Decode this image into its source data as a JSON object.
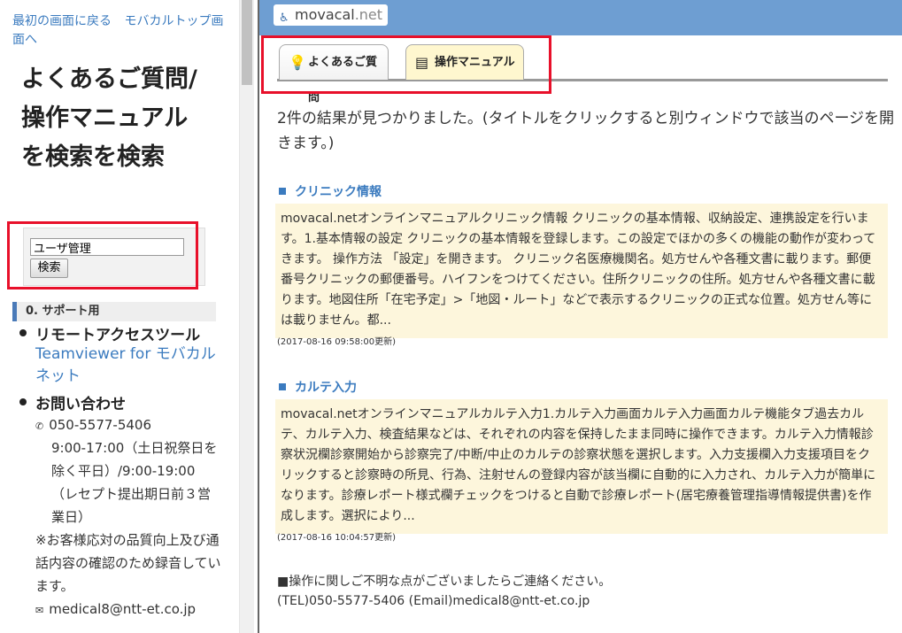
{
  "left_pane": {
    "link_back": "最初の画面に戻る",
    "link_top": "モバカルトップ画面へ",
    "title": "よくあるご質問/操作マニュアルを検索を検索",
    "search_value": "ユーザ管理",
    "search_button": "検索",
    "section_heading": "0. サポート用",
    "items": [
      {
        "title": "リモートアクセスツール",
        "link": "Teamviewer for モバカルネット"
      },
      {
        "title": "お問い合わせ"
      }
    ],
    "contact": {
      "phone": "050-5577-5406",
      "hours": "9:00-17:00（土日祝祭日を除く平日）/9:00-19:00（レセプト提出期日前３営業日）",
      "note": "※お客様応対の品質向上及び通話内容の確認のため録音しています。",
      "email": "medical8@ntt-et.co.jp"
    }
  },
  "header": {
    "logo_main": "movacal",
    "logo_net": ".net",
    "logo_icon": "movacal-logo-icon"
  },
  "tabs": [
    {
      "label": "よくあるご質問",
      "icon": "lightbulb-icon"
    },
    {
      "label": "操作マニュアル",
      "icon": "manual-book-icon"
    }
  ],
  "results_message": "2件の結果が見つかりました。(タイトルをクリックすると別ウィンドウで該当のページを開きます。)",
  "results": [
    {
      "title": "クリニック情報",
      "snippet": "movacal.netオンラインマニュアルクリニック情報 クリニックの基本情報、収納設定、連携設定を行います。1.基本情報の設定 クリニックの基本情報を登録します。この設定でほかの多くの機能の動作が変わってきます。 操作方法 「設定」を開きます。 クリニック名医療機関名。処方せんや各種文書に載ります。郵便番号クリニックの郵便番号。ハイフンをつけてください。住所クリニックの住所。処方せんや各種文書に載ります。地図住所「在宅予定」>「地図・ルート」などで表示するクリニックの正式な位置。処方せん等には載りません。都...",
      "updated": "(2017-08-16 09:58:00更新)"
    },
    {
      "title": "カルテ入力",
      "snippet": "movacal.netオンラインマニュアルカルテ入力1.カルテ入力画面カルテ入力画面カルテ機能タブ過去カルテ、カルテ入力、検査結果などは、それぞれの内容を保持したまま同時に操作できます。カルテ入力情報診察状況欄診察開始から診察完了/中断/中止のカルテの診察状態を選択します。入力支援欄入力支援項目をクリックすると診察時の所見、行為、注射せんの登録内容が該当欄に自動的に入力され、カルテ入力が簡単になります。診療レポート様式欄チェックをつけると自動で診療レポート(居宅療養管理指導情報提供書)を作成します。選択により...",
      "updated": "(2017-08-16 10:04:57更新)"
    }
  ],
  "footer": {
    "line1": "■操作に関しご不明な点がございましたらご連絡ください。",
    "line2": "(TEL)050-5577-5406 (Email)medical8@ntt-et.co.jp"
  }
}
